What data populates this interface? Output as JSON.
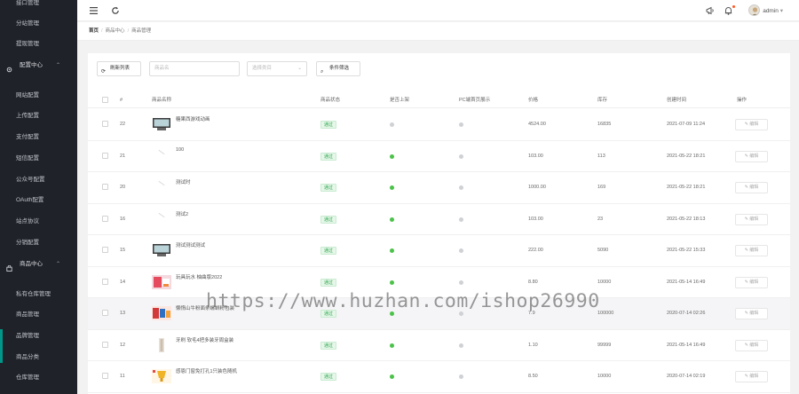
{
  "sidebar": {
    "items": [
      {
        "label": "接口管理",
        "type": "sub"
      },
      {
        "label": "分站管理",
        "type": "sub"
      },
      {
        "label": "提现管理",
        "type": "sub"
      },
      {
        "label": "配置中心",
        "type": "group",
        "icon": "gear-icon"
      },
      {
        "label": "网站配置",
        "type": "sub"
      },
      {
        "label": "上传配置",
        "type": "sub"
      },
      {
        "label": "支付配置",
        "type": "sub"
      },
      {
        "label": "短信配置",
        "type": "sub"
      },
      {
        "label": "公众号配置",
        "type": "sub"
      },
      {
        "label": "OAuth配置",
        "type": "sub"
      },
      {
        "label": "站点协议",
        "type": "sub"
      },
      {
        "label": "分销配置",
        "type": "sub"
      },
      {
        "label": "商品中心",
        "type": "group",
        "icon": "bag-icon"
      },
      {
        "label": "私有仓库管理",
        "type": "sub"
      },
      {
        "label": "商品管理",
        "type": "sub"
      },
      {
        "label": "品牌管理",
        "type": "sub"
      },
      {
        "label": "商品分类",
        "type": "sub"
      },
      {
        "label": "仓库管理",
        "type": "sub"
      }
    ]
  },
  "header": {
    "user": "admin",
    "icons": [
      "menu-icon",
      "refresh-icon",
      "megaphone-icon",
      "bell-icon",
      "avatar"
    ]
  },
  "breadcrumb": {
    "items": [
      "首页",
      "商品中心",
      "商品管理"
    ]
  },
  "toolbar": {
    "refresh_label": "刷新列表",
    "search_placeholder": "商品名",
    "category_placeholder": "选择类目",
    "filter_label": "条件筛选"
  },
  "table": {
    "columns": [
      "#",
      "商品名称",
      "商品状态",
      "是否上架",
      "PC端首页展示",
      "价格",
      "库存",
      "创建时间",
      "操作"
    ],
    "rows": [
      {
        "id": "22",
        "name": "糖果西游戏动画",
        "status": "通过",
        "on_shelf": false,
        "pc_home": false,
        "price": "4524.00",
        "stock": "16835",
        "created": "2021-07-09 11:24",
        "action": "编辑",
        "thumb": "screen"
      },
      {
        "id": "21",
        "name": "100",
        "status": "通过",
        "on_shelf": true,
        "pc_home": false,
        "price": "103.00",
        "stock": "113",
        "created": "2021-05-22 18:21",
        "action": "编辑",
        "thumb": "blank"
      },
      {
        "id": "20",
        "name": "测试时",
        "status": "通过",
        "on_shelf": true,
        "pc_home": false,
        "price": "1000.00",
        "stock": "169",
        "created": "2021-05-22 18:21",
        "action": "编辑",
        "thumb": "blank"
      },
      {
        "id": "16",
        "name": "测试2",
        "status": "通过",
        "on_shelf": true,
        "pc_home": false,
        "price": "103.00",
        "stock": "23",
        "created": "2021-05-22 18:13",
        "action": "编辑",
        "thumb": "blank"
      },
      {
        "id": "15",
        "name": "测试测试测试",
        "status": "通过",
        "on_shelf": true,
        "pc_home": false,
        "price": "222.00",
        "stock": "5090",
        "created": "2021-05-22 15:33",
        "action": "编辑",
        "thumb": "screen"
      },
      {
        "id": "14",
        "name": "玩具玩水 柚曲版2022",
        "status": "通过",
        "on_shelf": true,
        "pc_home": false,
        "price": "8.80",
        "stock": "10000",
        "created": "2021-05-14 16:49",
        "action": "编辑",
        "thumb": "product"
      },
      {
        "id": "13",
        "name": "懒惰山牛粉面条螺蛳粉包装",
        "status": "通过",
        "on_shelf": true,
        "pc_home": false,
        "price": "7.9",
        "stock": "100000",
        "created": "2020-07-14 02:26",
        "action": "编辑",
        "thumb": "product2"
      },
      {
        "id": "12",
        "name": "牙刷 软毛4把多装牙周盒装",
        "status": "通过",
        "on_shelf": true,
        "pc_home": false,
        "price": "1.10",
        "stock": "99999",
        "created": "2021-05-14 16:49",
        "action": "编辑",
        "thumb": "toothbrush"
      },
      {
        "id": "11",
        "name": "感恩门窗免打孔1只装色随机",
        "status": "通过",
        "on_shelf": true,
        "pc_home": false,
        "price": "8.50",
        "stock": "10000",
        "created": "2020-07-14 02:19",
        "action": "编辑",
        "thumb": "cup"
      }
    ]
  },
  "watermark": "https://www.huzhan.com/ishop26990"
}
